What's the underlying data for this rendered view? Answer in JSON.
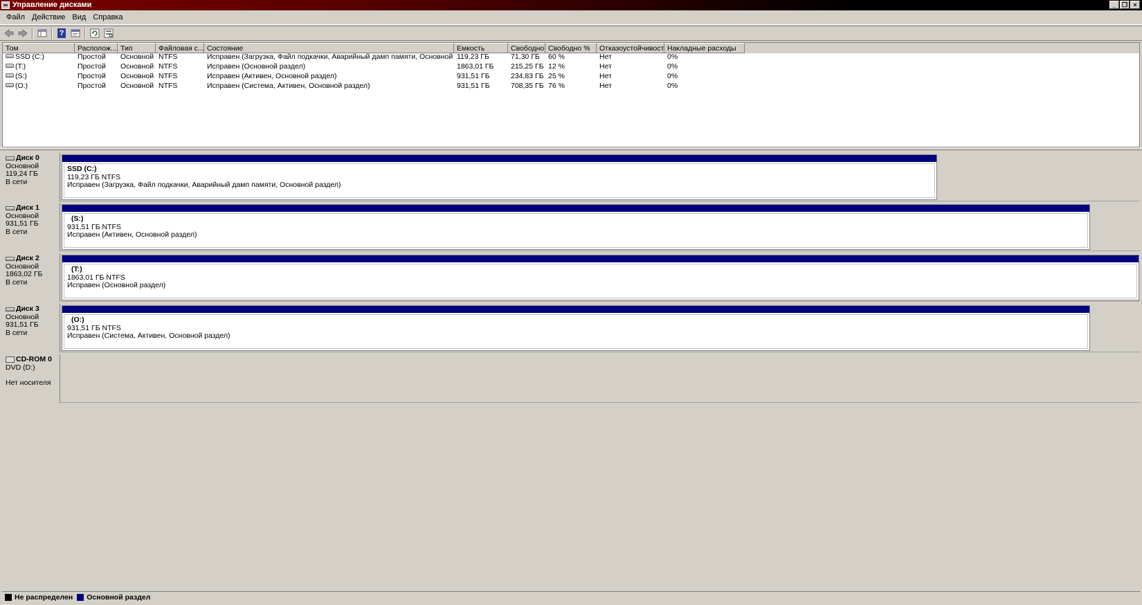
{
  "window": {
    "title": "Управление дисками",
    "buttons": [
      "_",
      "❐",
      "×"
    ]
  },
  "menu": [
    "Файл",
    "Действие",
    "Вид",
    "Справка"
  ],
  "toolbar": {
    "icons": [
      "back-icon",
      "forward-icon",
      "show-hide-icon",
      "help-icon",
      "properties-icon",
      "refresh-icon",
      "rescan-icon"
    ],
    "help_glyph": "?"
  },
  "volume_list": {
    "columns": [
      "Том",
      "Располож...",
      "Тип",
      "Файловая с...",
      "Состояние",
      "Емкость",
      "Свободно",
      "Свободно %",
      "Отказоустойчивость",
      "Накладные расходы"
    ],
    "rows": [
      [
        "SSD (C:)",
        "Простой",
        "Основной",
        "NTFS",
        "Исправен (Загрузка, Файл подкачки, Аварийный дамп памяти, Основной раздел)",
        "119,23 ГБ",
        "71,30 ГБ",
        "60 %",
        "Нет",
        "0%"
      ],
      [
        "(T:)",
        "Простой",
        "Основной",
        "NTFS",
        "Исправен (Основной раздел)",
        "1863,01 ГБ",
        "215,25 ГБ",
        "12 %",
        "Нет",
        "0%"
      ],
      [
        "(S:)",
        "Простой",
        "Основной",
        "NTFS",
        "Исправен (Активен, Основной раздел)",
        "931,51 ГБ",
        "234,83 ГБ",
        "25 %",
        "Нет",
        "0%"
      ],
      [
        "(O:)",
        "Простой",
        "Основной",
        "NTFS",
        "Исправен (Система, Активен, Основной раздел)",
        "931,51 ГБ",
        "708,35 ГБ",
        "76 %",
        "Нет",
        "0%"
      ]
    ]
  },
  "disks": [
    {
      "name": "Диск 0",
      "type": "Основной",
      "size": "119,24 ГБ",
      "status": "В сети",
      "partition": {
        "label": "SSD  (C:)",
        "size": "119,23 ГБ NTFS",
        "state": "Исправен (Загрузка, Файл подкачки, Аварийный дамп памяти, Основной раздел)"
      }
    },
    {
      "name": "Диск 1",
      "type": "Основной",
      "size": "931,51 ГБ",
      "status": "В сети",
      "partition": {
        "label": "(S:)",
        "size": "931,51 ГБ NTFS",
        "state": "Исправен (Активен, Основной раздел)"
      }
    },
    {
      "name": "Диск 2",
      "type": "Основной",
      "size": "1863,02 ГБ",
      "status": "В сети",
      "partition": {
        "label": "(T:)",
        "size": "1863,01 ГБ NTFS",
        "state": "Исправен (Основной раздел)"
      }
    },
    {
      "name": "Диск 3",
      "type": "Основной",
      "size": "931,51 ГБ",
      "status": "В сети",
      "partition": {
        "label": "(O:)",
        "size": "931,51 ГБ NTFS",
        "state": "Исправен (Система, Активен, Основной раздел)"
      }
    }
  ],
  "cdrom": {
    "name": "CD-ROM 0",
    "drive": "DVD (D:)",
    "media": "Нет носителя"
  },
  "legend": [
    {
      "label": "Не распределен",
      "color": "#000000"
    },
    {
      "label": "Основной раздел",
      "color": "#00007f"
    }
  ]
}
